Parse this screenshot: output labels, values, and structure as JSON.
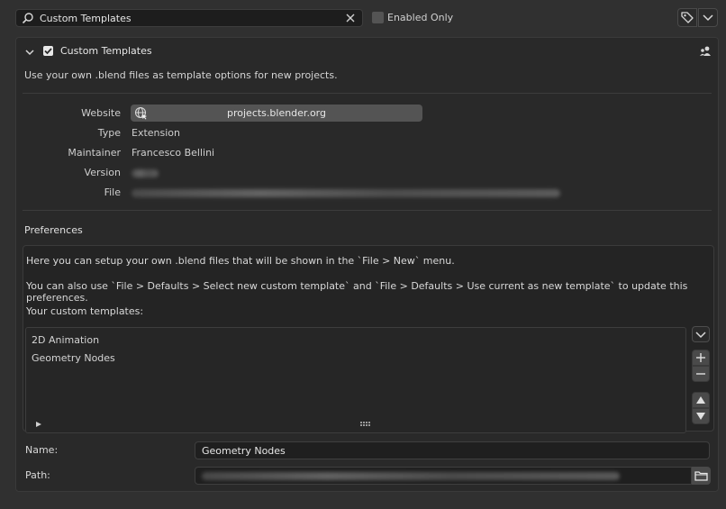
{
  "search": {
    "value": "Custom Templates"
  },
  "filter": {
    "enabled_only_label": "Enabled Only",
    "enabled_only_checked": false
  },
  "addon": {
    "name": "Custom Templates",
    "enabled": true,
    "description": "Use your own .blend files as template options for new projects.",
    "meta": {
      "website_label": "Website",
      "website_value": "projects.blender.org",
      "type_label": "Type",
      "type_value": "Extension",
      "maintainer_label": "Maintainer",
      "maintainer_value": "Francesco Bellini",
      "version_label": "Version",
      "version_value": "1.0.0",
      "file_label": "File",
      "file_value": "/media/doc/Videomaking/Blender My Add-On/Extensions/custom_templates/__init__.py"
    }
  },
  "preferences": {
    "title": "Preferences",
    "line1": "Here you can setup your own .blend files that will be shown in the `File > New` menu.",
    "line2": "You can also use `File > Defaults > Select new custom template` and `File > Defaults > Use current as new template` to update this preferences.",
    "line3": "Your custom templates:",
    "templates": [
      "2D Animation",
      "Geometry Nodes"
    ],
    "name_label": "Name:",
    "name_value": "Geometry Nodes",
    "path_label": "Path:",
    "path_value": "/media/doc/Videomaking/Blender projects/Templates/Geometry Nodes Ready.blend"
  },
  "colors": {
    "panel_bg": "#292929",
    "field_bg": "#1f1f1f",
    "button_bg": "#545454"
  }
}
